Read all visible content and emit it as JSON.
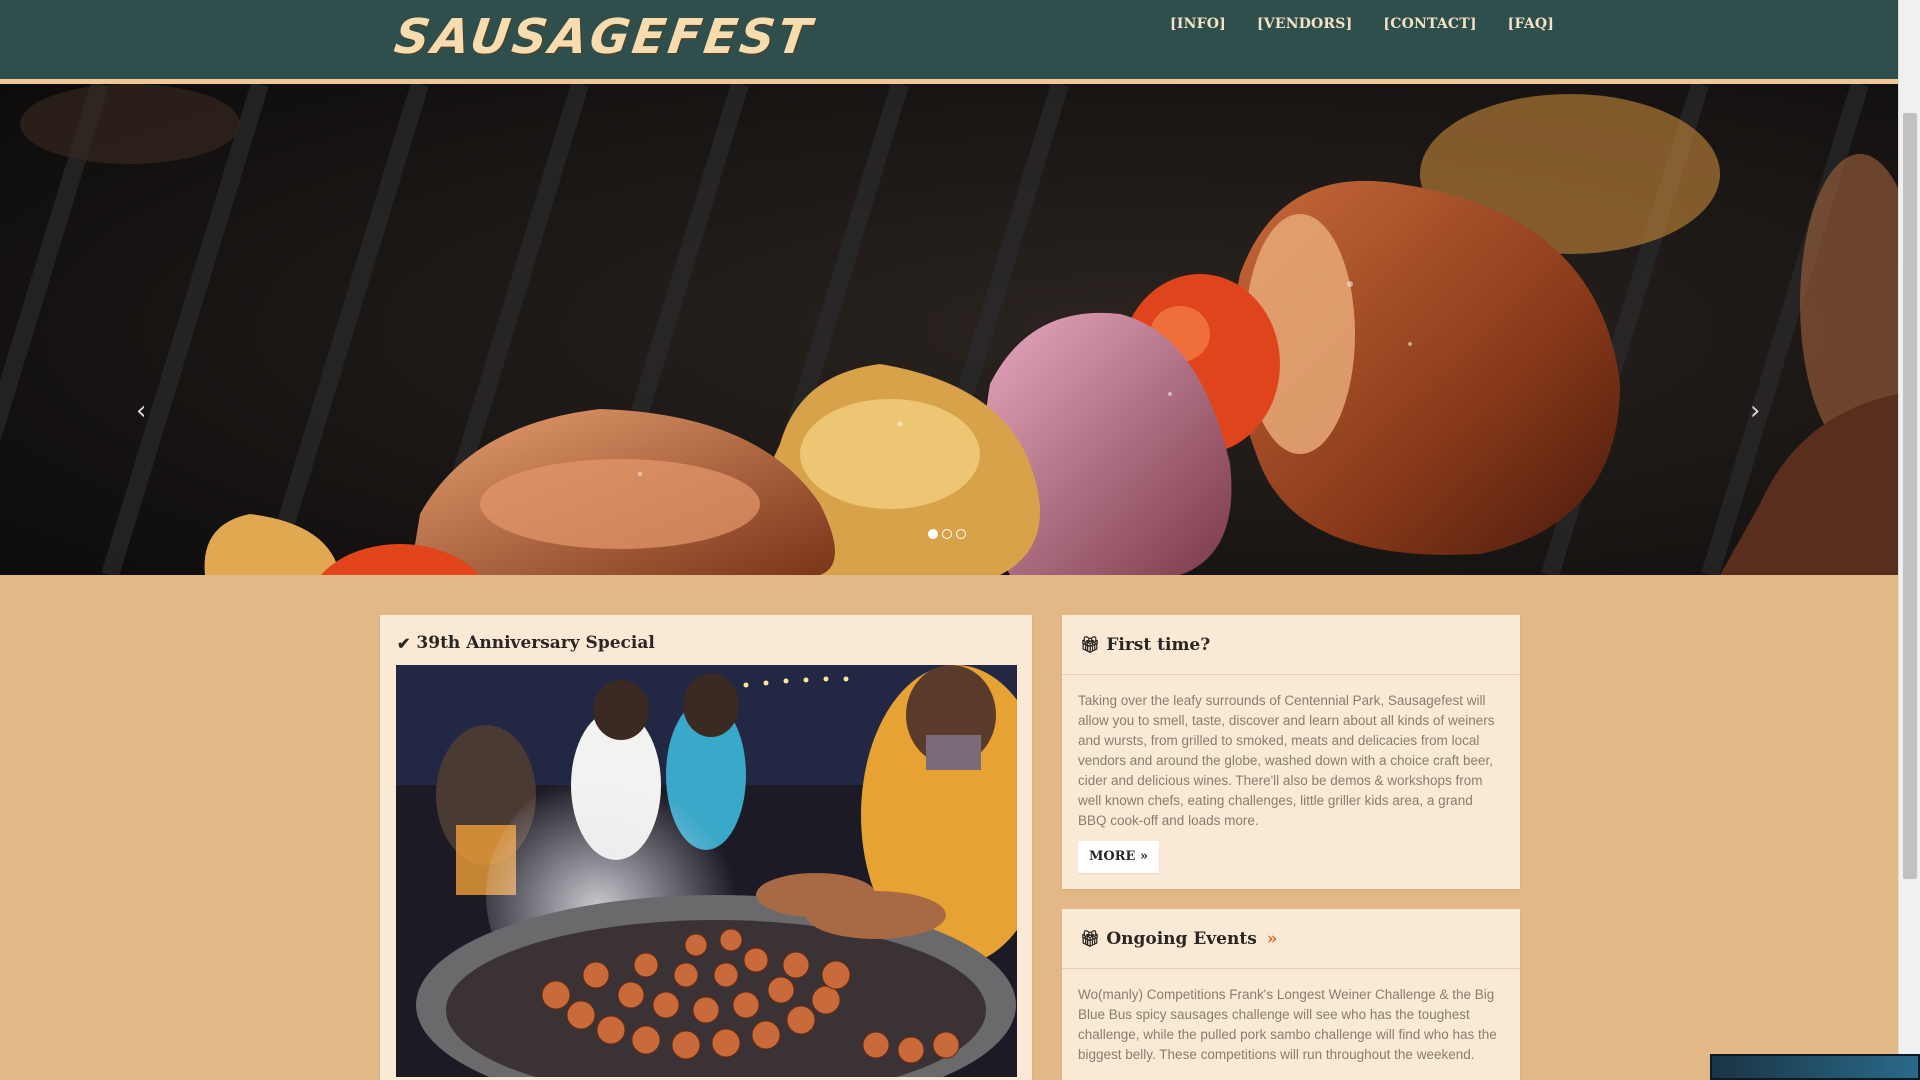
{
  "header": {
    "logo": "SAUSAGEFEST",
    "nav": [
      "[INFO]",
      "[VENDORS]",
      "[CONTACT]",
      "[FAQ]"
    ]
  },
  "carousel": {
    "prev": "‹",
    "next": "›",
    "slide_count": 3,
    "active_slide": 1
  },
  "anniversary": {
    "title": "39th Anniversary Special",
    "icon": "check-icon"
  },
  "first_time": {
    "title": "First time?",
    "icon": "gift-icon",
    "body": "Taking over the leafy surrounds of Centennial Park, Sausagefest will allow you to smell, taste, discover and learn about all kinds of weiners and wursts, from grilled to smoked, meats and delicacies from local vendors and around the globe, washed down with a choice craft beer, cider and delicious wines. There'll also be demos & workshops from well known chefs, eating challenges, little griller kids area, a grand BBQ cook-off and loads more.",
    "more": "MORE »"
  },
  "ongoing": {
    "title": "Ongoing Events",
    "title_suffix": "»",
    "icon": "gift-icon",
    "body": "Wo(manly) Competitions Frank's Longest Weiner Challenge & the Big Blue Bus spicy sausages challenge will see who has the toughest challenge, while the pulled pork sambo challenge will find who has the biggest belly. These competitions will run throughout the weekend."
  },
  "colors": {
    "header_bg": "#2f4f4d",
    "page_bg": "#e2b886",
    "card_bg": "#fae9d5",
    "logo": "#f6dcae",
    "accent": "#d96a2a"
  }
}
